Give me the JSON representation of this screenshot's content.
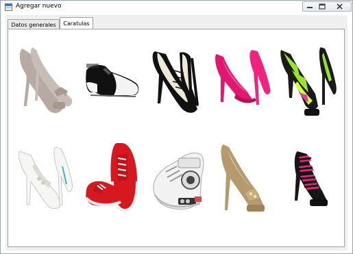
{
  "window": {
    "title": "Agregar nuevo"
  },
  "tabs": [
    {
      "label": "Datos generales",
      "selected": false
    },
    {
      "label": "Caratulas",
      "selected": true
    }
  ],
  "covers": [
    {
      "name": "nude-bow-platform-pump-image"
    },
    {
      "name": "black-white-oxford-shoe-image"
    },
    {
      "name": "cream-black-laceup-heel-image"
    },
    {
      "name": "hot-pink-stiletto-pump-image"
    },
    {
      "name": "neon-print-platform-heel-image"
    },
    {
      "name": "white-lace-peeptoe-heel-image"
    },
    {
      "name": "red-canvas-sneakers-image"
    },
    {
      "name": "white-boombox-sneaker-image"
    },
    {
      "name": "gold-platform-heel-image"
    },
    {
      "name": "black-pink-strappy-heel-image"
    }
  ],
  "colors": {
    "window_bg": "#f0f0f0",
    "panel_bg": "#ffffff",
    "border": "#a0a0a0"
  }
}
